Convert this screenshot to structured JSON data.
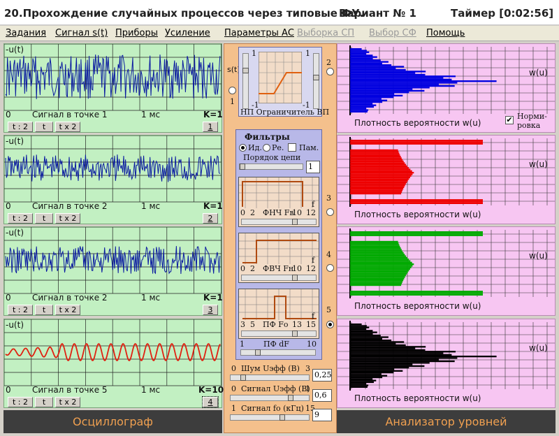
{
  "window": {
    "title": "20.Прохождение случайных процессов через типовые ФУ.",
    "variant": "Вариант № 1",
    "timer": "Таймер [0:02:56]"
  },
  "menu": [
    "Задания",
    "Сигнал s(t)",
    "Приборы",
    "Усиление",
    "Параметры АС",
    "Выборка СП",
    "Выбор СФ",
    "Помощь"
  ],
  "oscilloscope": {
    "section_label": "Осциллограф",
    "y_label": "-u(t)",
    "time_start": "0",
    "time_unit": "1 мс",
    "buttons": {
      "shrink": "t : 2",
      "t": "t",
      "expand": "t x 2"
    },
    "channels": [
      {
        "caption": "Сигнал в точке 1",
        "gain": "K=1",
        "point": "1",
        "color": "#0a1aa0"
      },
      {
        "caption": "Сигнал в точке 2",
        "gain": "K=1",
        "point": "2",
        "color": "#0a1aa0"
      },
      {
        "caption": "Сигнал в точке 2",
        "gain": "K=1",
        "point": "3",
        "color": "#0a1aa0"
      },
      {
        "caption": "Сигнал в точке 5",
        "gain": "K=10",
        "point": "4",
        "color": "#e02010"
      }
    ]
  },
  "analyzer": {
    "section_label": "Анализатор уровней",
    "axis_label": "w(u)",
    "caption": "Плотность вероятности  w(u)",
    "normalize_label": "Норми-\nровка",
    "normalize_checked": true,
    "check_mark": "✔",
    "plots": [
      {
        "color": "#0000e0",
        "shape": "decay"
      },
      {
        "color": "#ee0000",
        "shape": "limited"
      },
      {
        "color": "#00aa00",
        "shape": "limited"
      },
      {
        "color": "#000000",
        "shape": "decay"
      }
    ]
  },
  "limiter": {
    "label": "НП Ограничитель ВП",
    "s_label": "s(t)",
    "scale": {
      "left_top": "1",
      "left_bottom": "-1",
      "right_top": "1",
      "right_bottom": "-1",
      "port_left": "1",
      "port_right": "2"
    }
  },
  "filters": {
    "title": "Фильтры",
    "radio_ideal": "Ид.",
    "radio_real": "Ре.",
    "memory": "Пам.",
    "order_label": "Порядок цепи",
    "order_value": "1",
    "lpf": {
      "ticks": [
        "0",
        "2",
        "ФНЧ Fв",
        "10",
        "12"
      ],
      "f": "f",
      "port": "3"
    },
    "hpf": {
      "ticks": [
        "0",
        "2",
        "ФВЧ Fн",
        "10",
        "12"
      ],
      "f": "f",
      "port": "4"
    },
    "bpf": {
      "ticks": [
        "3",
        "5",
        "ПФ Fо",
        "13",
        "15"
      ],
      "f": "f",
      "port": "5"
    },
    "bpf_width": {
      "min": "1",
      "label": "ПФ dF",
      "max": "10"
    }
  },
  "params": [
    {
      "min": "0",
      "label": "Шум Uэфф (В)",
      "max": "3",
      "value": "0,25"
    },
    {
      "min": "0",
      "label": "Сигнал Uэфф (В)",
      "max": "1",
      "value": "0,6"
    },
    {
      "min": "1",
      "label": "Сигнал fo (кГц)",
      "max": "15",
      "value": "9"
    }
  ]
}
